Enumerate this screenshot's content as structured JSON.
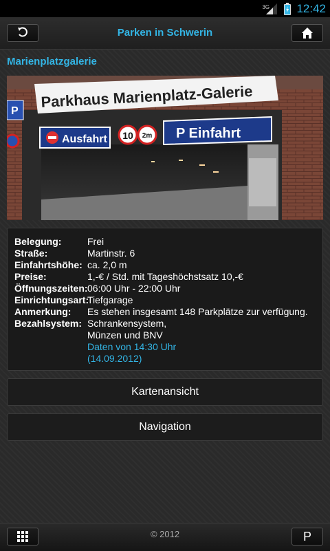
{
  "status_bar": {
    "network": "3G",
    "time": "12:42"
  },
  "header": {
    "title": "Parken in Schwerin",
    "back_icon": "back-arrow-icon",
    "home_icon": "home-icon"
  },
  "facility": {
    "name": "Marienplatzgalerie",
    "photo": {
      "sign_main": "Parkhaus Marienplatz-Galerie",
      "sign_exit": "Ausfahrt",
      "sign_entry": "P Einfahrt",
      "limit_speed": "10",
      "limit_height": "2m",
      "side_sign": "P"
    },
    "details": [
      {
        "label": "Belegung:",
        "lines": [
          "Frei"
        ]
      },
      {
        "label": "Straße:",
        "lines": [
          "Martinstr. 6"
        ]
      },
      {
        "label": "Einfahrtshöhe:",
        "lines": [
          "ca. 2,0 m"
        ]
      },
      {
        "label": "Preise:",
        "lines": [
          "1,-€ / Std. mit Tageshöchstsatz 10,-€"
        ]
      },
      {
        "label": "Öffnungszeiten:",
        "lines": [
          "06:00 Uhr - 22:00 Uhr"
        ]
      },
      {
        "label": "Einrichtungsart:",
        "lines": [
          "Tiefgarage"
        ]
      },
      {
        "label": "Anmerkung:",
        "lines": [
          "Es stehen insgesamt 148 Parkplätze zur verfügung."
        ]
      },
      {
        "label": "Bezahlsystem:",
        "lines": [
          "Schrankensystem,",
          "Münzen und BNV"
        ]
      }
    ],
    "data_source": {
      "line1": "Daten von 14:30 Uhr",
      "line2": "(14.09.2012)"
    }
  },
  "actions": {
    "map_view": "Kartenansicht",
    "navigation": "Navigation"
  },
  "footer": {
    "copyright": "© 2012",
    "grid_icon": "grid-icon",
    "parking_label": "P"
  },
  "colors": {
    "accent": "#33b5e5",
    "background": "#2a2a2a",
    "panel": "#1a1a1a"
  }
}
